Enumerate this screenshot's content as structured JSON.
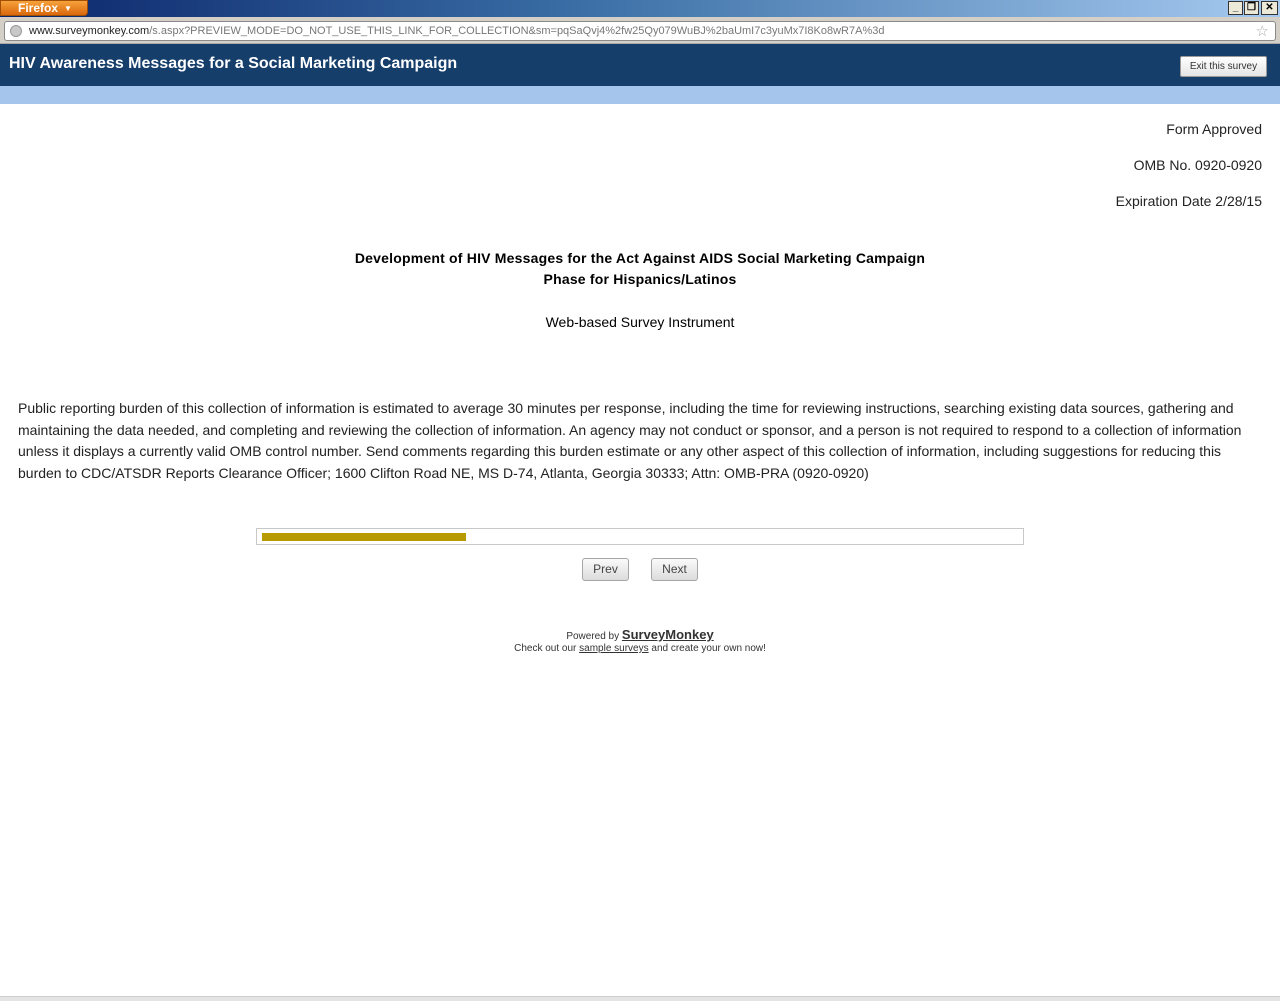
{
  "browser": {
    "menu_label": "Firefox",
    "url_domain": "www.surveymonkey.com",
    "url_path": "/s.aspx?PREVIEW_MODE=DO_NOT_USE_THIS_LINK_FOR_COLLECTION&sm=pqSaQvj4%2fw25Qy079WuBJ%2baUmI7c3yuMx7I8Ko8wR7A%3d",
    "controls": {
      "minimize": "_",
      "restore": "❐",
      "close": "✕"
    }
  },
  "header": {
    "title": "HIV Awareness Messages for a Social Marketing Campaign",
    "exit_label": "Exit this survey"
  },
  "omb": {
    "approved": "Form Approved",
    "number": "OMB No. 0920-0920",
    "expiration": "Expiration Date 2/28/15"
  },
  "survey": {
    "title_line1": "Development of HIV Messages for the Act Against AIDS Social Marketing Campaign",
    "title_line2": "Phase for Hispanics/Latinos",
    "subtitle": "Web-based Survey Instrument",
    "burden_text": "Public reporting burden of this collection of information is estimated to average 30 minutes per response, including the time for reviewing instructions, searching existing data sources, gathering and maintaining the data needed, and completing and reviewing the collection of information. An agency may not conduct or sponsor, and a person is not required to respond to a collection of information unless it displays a currently valid OMB control number. Send comments regarding this burden estimate or any other aspect of this collection of information, including suggestions for reducing this burden to CDC/ATSDR Reports Clearance Officer; 1600 Clifton Road NE, MS D-74, Atlanta, Georgia 30333; Attn: OMB-PRA (0920-0920)"
  },
  "progress": {
    "fraction": 0.27,
    "color": "#b89a05"
  },
  "nav": {
    "prev_label": "Prev",
    "next_label": "Next"
  },
  "footer": {
    "powered_by": "Powered by",
    "brand": "SurveyMonkey",
    "check_out": "Check out our",
    "sample_link": "sample surveys",
    "create_text": "and create your own now!"
  },
  "colors": {
    "header_bg": "#163e6b",
    "band": "#a6c5ec"
  }
}
